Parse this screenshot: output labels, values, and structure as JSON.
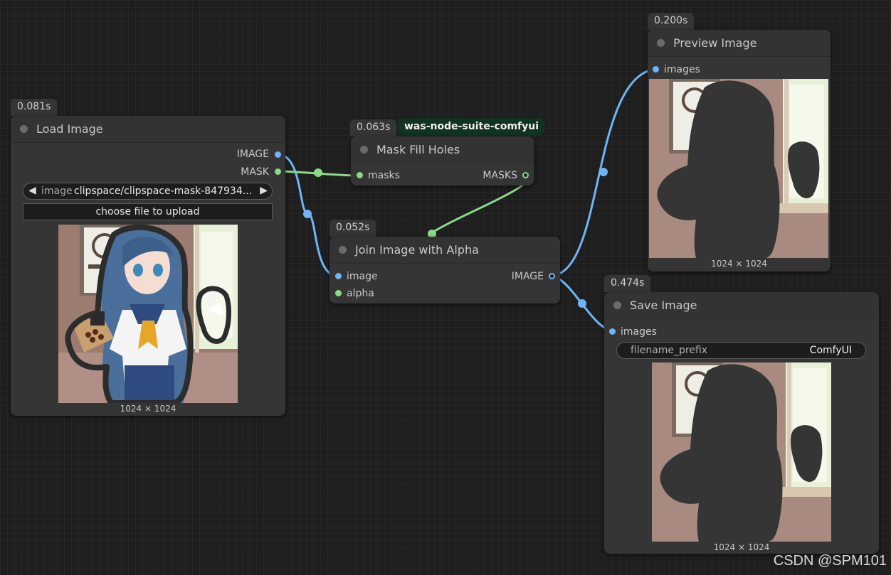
{
  "colors": {
    "image_link": "#6fb5f5",
    "mask_link": "#8bd98b",
    "node_bg": "#353535",
    "canvas_bg": "#1e1e1e"
  },
  "nodes": {
    "load_image": {
      "time": "0.081s",
      "title": "Load Image",
      "outputs": [
        "IMAGE",
        "MASK"
      ],
      "widget_label": "image",
      "widget_value": "clipspace/clipspace-mask-847934...",
      "upload_label": "choose file to upload",
      "image_size": "1024 × 1024"
    },
    "mask_fill_holes": {
      "time": "0.063s",
      "source_tag": "was-node-suite-comfyui",
      "title": "Mask Fill Holes",
      "input": "masks",
      "output": "MASKS"
    },
    "join_image_alpha": {
      "time": "0.052s",
      "title": "Join Image with Alpha",
      "inputs": [
        "image",
        "alpha"
      ],
      "output": "IMAGE"
    },
    "preview_image": {
      "time": "0.200s",
      "title": "Preview Image",
      "input": "images",
      "image_size": "1024 × 1024"
    },
    "save_image": {
      "time": "0.474s",
      "title": "Save Image",
      "input": "images",
      "prefix_label": "filename_prefix",
      "prefix_value": "ComfyUI",
      "image_size": "1024 × 1024"
    }
  },
  "watermark": "CSDN @SPM101"
}
